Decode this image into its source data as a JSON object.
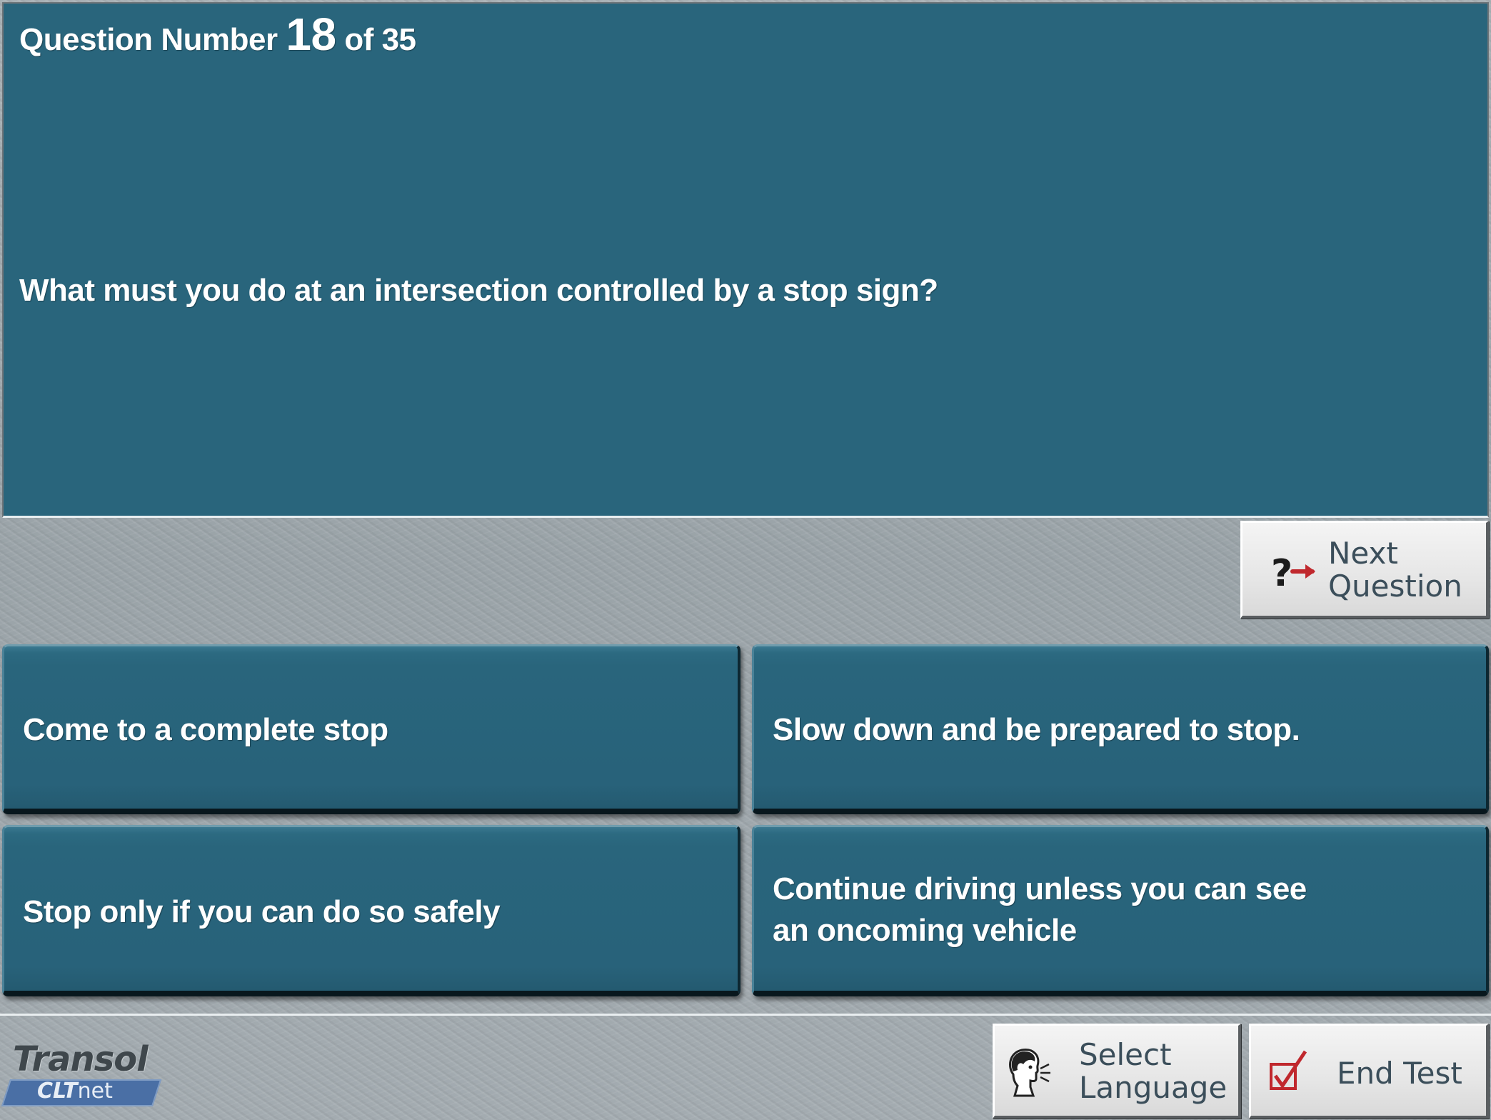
{
  "question": {
    "label_prefix": "Question Number",
    "number": "18",
    "of_label": "of 35",
    "text": "What must you do at an intersection controlled by a stop sign?"
  },
  "answers": [
    {
      "text": "Come to a complete stop"
    },
    {
      "text": "Slow down and be prepared to stop."
    },
    {
      "text": "Stop only if you can do so safely"
    },
    {
      "text": "Continue driving unless you can see an oncoming vehicle"
    }
  ],
  "buttons": {
    "next": {
      "line1": "Next",
      "line2": "Question",
      "icon": "question-arrow-icon"
    },
    "language": {
      "line1": "Select",
      "line2": "Language",
      "icon": "speaking-head-icon"
    },
    "end_test": {
      "label": "End Test",
      "icon": "checkbox-check-icon"
    }
  },
  "logo": {
    "brand": "Transol",
    "product_bold": "CLT",
    "product_rest": "net"
  },
  "colors": {
    "panel": "#29657c",
    "background_gray": "#a3abb0",
    "button_text": "#3b4e5a",
    "accent_red": "#c0282d"
  }
}
